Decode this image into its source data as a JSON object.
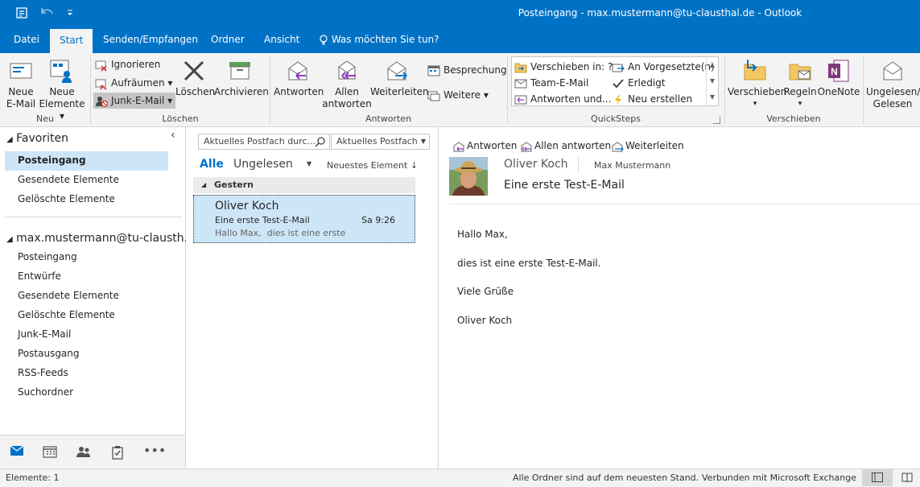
{
  "window": {
    "title": "Posteingang - max.mustermann@tu-clausthal.de - Outlook"
  },
  "tabs": [
    {
      "label": "Datei"
    },
    {
      "label": "Start"
    },
    {
      "label": "Senden/Empfangen"
    },
    {
      "label": "Ordner"
    },
    {
      "label": "Ansicht"
    },
    {
      "label": "Was möchten Sie tun?"
    }
  ],
  "ribbon": {
    "neu": {
      "group": "Neu",
      "new_email": [
        "Neue",
        "E-Mail"
      ],
      "new_items": [
        "Neue",
        "Elemente"
      ]
    },
    "loeschen": {
      "group": "Löschen",
      "ignore": "Ignorieren",
      "cleanup": "Aufräumen",
      "junk": "Junk-E-Mail",
      "delete": "Löschen",
      "archive": "Archivieren"
    },
    "antworten": {
      "group": "Antworten",
      "reply": "Antworten",
      "reply_all": [
        "Allen",
        "antworten"
      ],
      "forward": "Weiterleiten",
      "meeting": "Besprechung",
      "more": "Weitere"
    },
    "quicksteps": {
      "group": "QuickSteps",
      "move_to": "Verschieben in: ?",
      "team_email": "Team-E-Mail",
      "reply_delete": "Antworten und...",
      "to_manager": "An Vorgesetzte(n)",
      "done": "Erledigt",
      "create_new": "Neu erstellen"
    },
    "verschieben": {
      "group": "Verschieben",
      "move": "Verschieben",
      "rules": "Regeln",
      "onenote": "OneNote"
    },
    "markieren": {
      "unread_read": [
        "Ungelesen/",
        "Gelesen"
      ]
    }
  },
  "nav": {
    "favorites_header": "Favoriten",
    "favorites": [
      "Posteingang",
      "Gesendete Elemente",
      "Gelöschte Elemente"
    ],
    "account_header": "max.mustermann@tu-clausth...",
    "folders": [
      "Posteingang",
      "Entwürfe",
      "Gesendete Elemente",
      "Gelöschte Elemente",
      "Junk-E-Mail",
      "Postausgang",
      "RSS-Feeds",
      "Suchordner"
    ]
  },
  "list": {
    "search_placeholder": "Aktuelles Postfach durc...",
    "scope": "Aktuelles Postfach",
    "filter_all": "Alle",
    "filter_unread": "Ungelesen",
    "sort": "Neuestes Element",
    "group": "Gestern",
    "messages": [
      {
        "sender": "Oliver Koch",
        "subject": "Eine erste Test-E-Mail",
        "time": "Sa 9:26",
        "preview": "Hallo Max,  dies ist eine erste"
      }
    ]
  },
  "reading": {
    "reply": "Antworten",
    "reply_all": "Allen antworten",
    "forward": "Weiterleiten",
    "from": "Oliver Koch",
    "to": "Max Mustermann",
    "subject": "Eine erste Test-E-Mail",
    "body": [
      "Hallo Max,",
      "dies ist eine erste Test-E-Mail.",
      "Viele Grüße",
      "Oliver Koch"
    ]
  },
  "status": {
    "items": "Elemente: 1",
    "sync": "Alle Ordner sind auf dem neuesten Stand.",
    "connection": "Verbunden mit Microsoft Exchange"
  },
  "icons": {
    "app": "outlook-send-receive-icon",
    "undo": "undo-icon",
    "customize": "customize-qat-icon",
    "lightbulb": "lightbulb-icon",
    "search": "search-icon"
  },
  "colors": {
    "accent": "#0072c6",
    "selection": "#cde6f7",
    "ribbon_bg": "#f3f3f3"
  }
}
